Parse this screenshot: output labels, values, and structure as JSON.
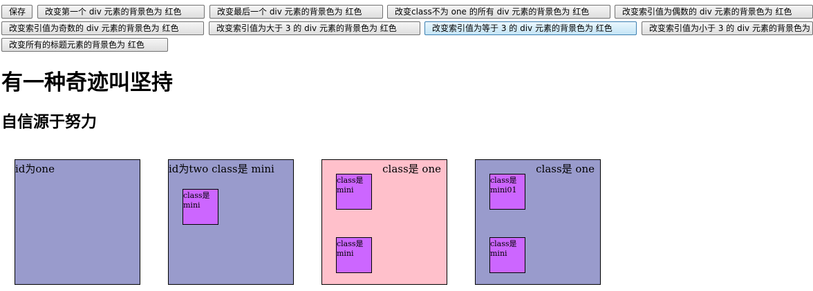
{
  "toolbar": {
    "buttons": [
      "保存",
      "改变第一个 div 元素的背景色为 红色",
      "改变最后一个 div 元素的背景色为 红色",
      "改变class不为 one 的所有 div 元素的背景色为 红色",
      "改变索引值为偶数的 div 元素的背景色为 红色",
      "改变索引值为奇数的 div 元素的背景色为 红色",
      "改变索引值为大于 3 的 div 元素的背景色为 红色",
      "改变索引值为等于 3 的 div 元素的背景色为 红色",
      "改变索引值为小于 3 的 div 元素的背景色为 红色",
      "改变所有的标题元素的背景色为 红色"
    ]
  },
  "headings": {
    "h1": "有一种奇迹叫坚持",
    "h2": "自信源于努力"
  },
  "boxes": [
    {
      "label": "id为one",
      "color": "#999bcc"
    },
    {
      "label": "id为two class是 mini",
      "color": "#999bcc",
      "minis": [
        {
          "line1": "class是",
          "line2": "mini",
          "color": "#cc66ff"
        }
      ]
    },
    {
      "label": "class是 one",
      "color": "#ffc0cb",
      "minis": [
        {
          "line1": "class是",
          "line2": "mini",
          "color": "#cc66ff"
        },
        {
          "line1": "class是",
          "line2": "mini",
          "color": "#cc66ff"
        }
      ]
    },
    {
      "label": "class是 one",
      "color": "#999bcc",
      "minis": [
        {
          "line1": "class是",
          "line2": "mini01",
          "color": "#cc66ff"
        },
        {
          "line1": "class是",
          "line2": "mini",
          "color": "#cc66ff"
        }
      ]
    }
  ]
}
